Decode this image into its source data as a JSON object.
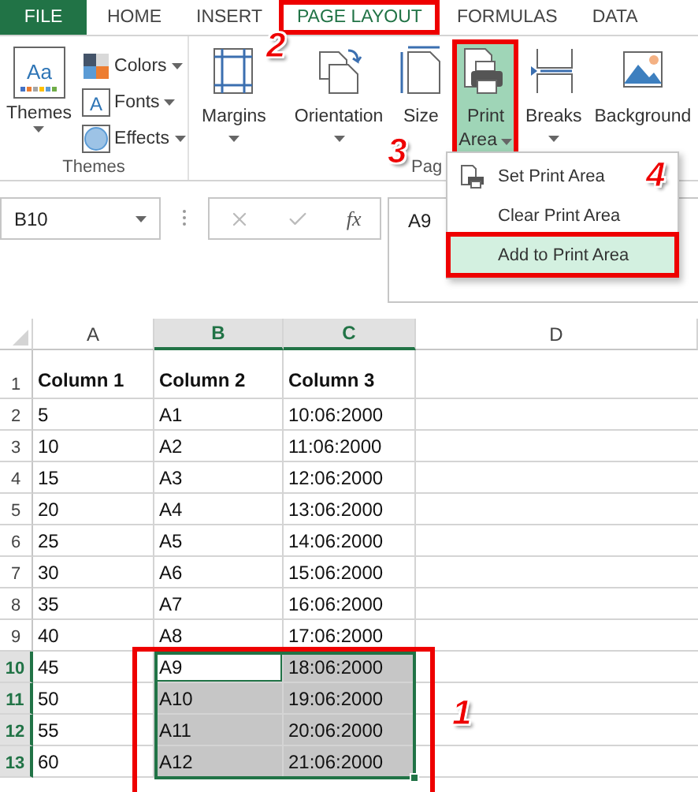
{
  "tabs": [
    {
      "label": "FILE",
      "kind": "file",
      "selected": false,
      "highlighted": false
    },
    {
      "label": "HOME",
      "kind": "tab",
      "selected": false,
      "highlighted": false
    },
    {
      "label": "INSERT",
      "kind": "tab",
      "selected": false,
      "highlighted": false
    },
    {
      "label": "PAGE LAYOUT",
      "kind": "tab",
      "selected": true,
      "highlighted": true
    },
    {
      "label": "FORMULAS",
      "kind": "tab",
      "selected": false,
      "highlighted": false
    },
    {
      "label": "DATA",
      "kind": "tab",
      "selected": false,
      "highlighted": false
    }
  ],
  "ribbon": {
    "themes_group": {
      "label": "Themes",
      "big_button": {
        "label": "Themes",
        "icon_text": "Aa"
      },
      "small_buttons": [
        {
          "label": "Colors",
          "kind": "colors"
        },
        {
          "label": "Fonts",
          "kind": "fonts",
          "icon_text": "A"
        },
        {
          "label": "Effects",
          "kind": "effects"
        }
      ]
    },
    "page_setup_group": {
      "label": "Pag",
      "buttons": [
        {
          "lines": [
            "Margins"
          ],
          "kind": "margins",
          "caret": true,
          "selected": false,
          "highlighted": false
        },
        {
          "lines": [
            "Orientation"
          ],
          "kind": "orientation",
          "caret": true,
          "selected": false,
          "highlighted": false
        },
        {
          "lines": [
            "Size"
          ],
          "kind": "size",
          "caret": false,
          "selected": false,
          "highlighted": false
        },
        {
          "lines": [
            "Print",
            "Area"
          ],
          "kind": "print",
          "caret": true,
          "selected": true,
          "highlighted": true
        },
        {
          "lines": [
            "Breaks"
          ],
          "kind": "breaks",
          "caret": true,
          "selected": false,
          "highlighted": false
        },
        {
          "lines": [
            "Background"
          ],
          "kind": "background",
          "caret": false,
          "selected": false,
          "highlighted": false
        }
      ]
    }
  },
  "print_area_menu": {
    "items": [
      {
        "label": "Set Print Area",
        "icon": true,
        "selected": false,
        "highlighted": false
      },
      {
        "label": "Clear Print Area",
        "icon": false,
        "selected": false,
        "highlighted": false
      },
      {
        "label": "Add to Print Area",
        "icon": false,
        "selected": true,
        "highlighted": true
      }
    ]
  },
  "formula_bar": {
    "name_box": "B10",
    "function_symbol": "fx",
    "value": "A9"
  },
  "sheet": {
    "columns": [
      {
        "label": "A",
        "selected": false
      },
      {
        "label": "B",
        "selected": true
      },
      {
        "label": "C",
        "selected": true
      },
      {
        "label": "D",
        "selected": false
      }
    ],
    "selection_highlighted": true,
    "rows": [
      {
        "header": "1",
        "kind": "header",
        "selected": false,
        "cells": [
          {
            "value": "Column 1",
            "selected": false,
            "active": false
          },
          {
            "value": "Column 2",
            "selected": false,
            "active": false
          },
          {
            "value": "Column 3",
            "selected": false,
            "active": false
          }
        ]
      },
      {
        "header": "2",
        "kind": "data",
        "selected": false,
        "cells": [
          {
            "value": "5",
            "selected": false,
            "active": false
          },
          {
            "value": "A1",
            "selected": false,
            "active": false
          },
          {
            "value": "10:06:2000",
            "selected": false,
            "active": false
          }
        ]
      },
      {
        "header": "3",
        "kind": "data",
        "selected": false,
        "cells": [
          {
            "value": "10",
            "selected": false,
            "active": false
          },
          {
            "value": "A2",
            "selected": false,
            "active": false
          },
          {
            "value": "11:06:2000",
            "selected": false,
            "active": false
          }
        ]
      },
      {
        "header": "4",
        "kind": "data",
        "selected": false,
        "cells": [
          {
            "value": "15",
            "selected": false,
            "active": false
          },
          {
            "value": "A3",
            "selected": false,
            "active": false
          },
          {
            "value": "12:06:2000",
            "selected": false,
            "active": false
          }
        ]
      },
      {
        "header": "5",
        "kind": "data",
        "selected": false,
        "cells": [
          {
            "value": "20",
            "selected": false,
            "active": false
          },
          {
            "value": "A4",
            "selected": false,
            "active": false
          },
          {
            "value": "13:06:2000",
            "selected": false,
            "active": false
          }
        ]
      },
      {
        "header": "6",
        "kind": "data",
        "selected": false,
        "cells": [
          {
            "value": "25",
            "selected": false,
            "active": false
          },
          {
            "value": "A5",
            "selected": false,
            "active": false
          },
          {
            "value": "14:06:2000",
            "selected": false,
            "active": false
          }
        ]
      },
      {
        "header": "7",
        "kind": "data",
        "selected": false,
        "cells": [
          {
            "value": "30",
            "selected": false,
            "active": false
          },
          {
            "value": "A6",
            "selected": false,
            "active": false
          },
          {
            "value": "15:06:2000",
            "selected": false,
            "active": false
          }
        ]
      },
      {
        "header": "8",
        "kind": "data",
        "selected": false,
        "cells": [
          {
            "value": "35",
            "selected": false,
            "active": false
          },
          {
            "value": "A7",
            "selected": false,
            "active": false
          },
          {
            "value": "16:06:2000",
            "selected": false,
            "active": false
          }
        ]
      },
      {
        "header": "9",
        "kind": "data",
        "selected": false,
        "cells": [
          {
            "value": "40",
            "selected": false,
            "active": false
          },
          {
            "value": "A8",
            "selected": false,
            "active": false
          },
          {
            "value": "17:06:2000",
            "selected": false,
            "active": false
          }
        ]
      },
      {
        "header": "10",
        "kind": "data",
        "selected": true,
        "cells": [
          {
            "value": "45",
            "selected": false,
            "active": false
          },
          {
            "value": "A9",
            "selected": false,
            "active": true
          },
          {
            "value": "18:06:2000",
            "selected": true,
            "active": false
          }
        ]
      },
      {
        "header": "11",
        "kind": "data",
        "selected": true,
        "cells": [
          {
            "value": "50",
            "selected": false,
            "active": false
          },
          {
            "value": "A10",
            "selected": true,
            "active": false
          },
          {
            "value": "19:06:2000",
            "selected": true,
            "active": false
          }
        ]
      },
      {
        "header": "12",
        "kind": "data",
        "selected": true,
        "cells": [
          {
            "value": "55",
            "selected": false,
            "active": false
          },
          {
            "value": "A11",
            "selected": true,
            "active": false
          },
          {
            "value": "20:06:2000",
            "selected": true,
            "active": false
          }
        ]
      },
      {
        "header": "13",
        "kind": "data",
        "selected": true,
        "cells": [
          {
            "value": "60",
            "selected": false,
            "active": false
          },
          {
            "value": "A12",
            "selected": true,
            "active": false
          },
          {
            "value": "21:06:2000",
            "selected": true,
            "active": false
          }
        ]
      }
    ]
  },
  "annotations": [
    {
      "label": "1"
    },
    {
      "label": "2"
    },
    {
      "label": "3"
    },
    {
      "label": "4"
    }
  ]
}
